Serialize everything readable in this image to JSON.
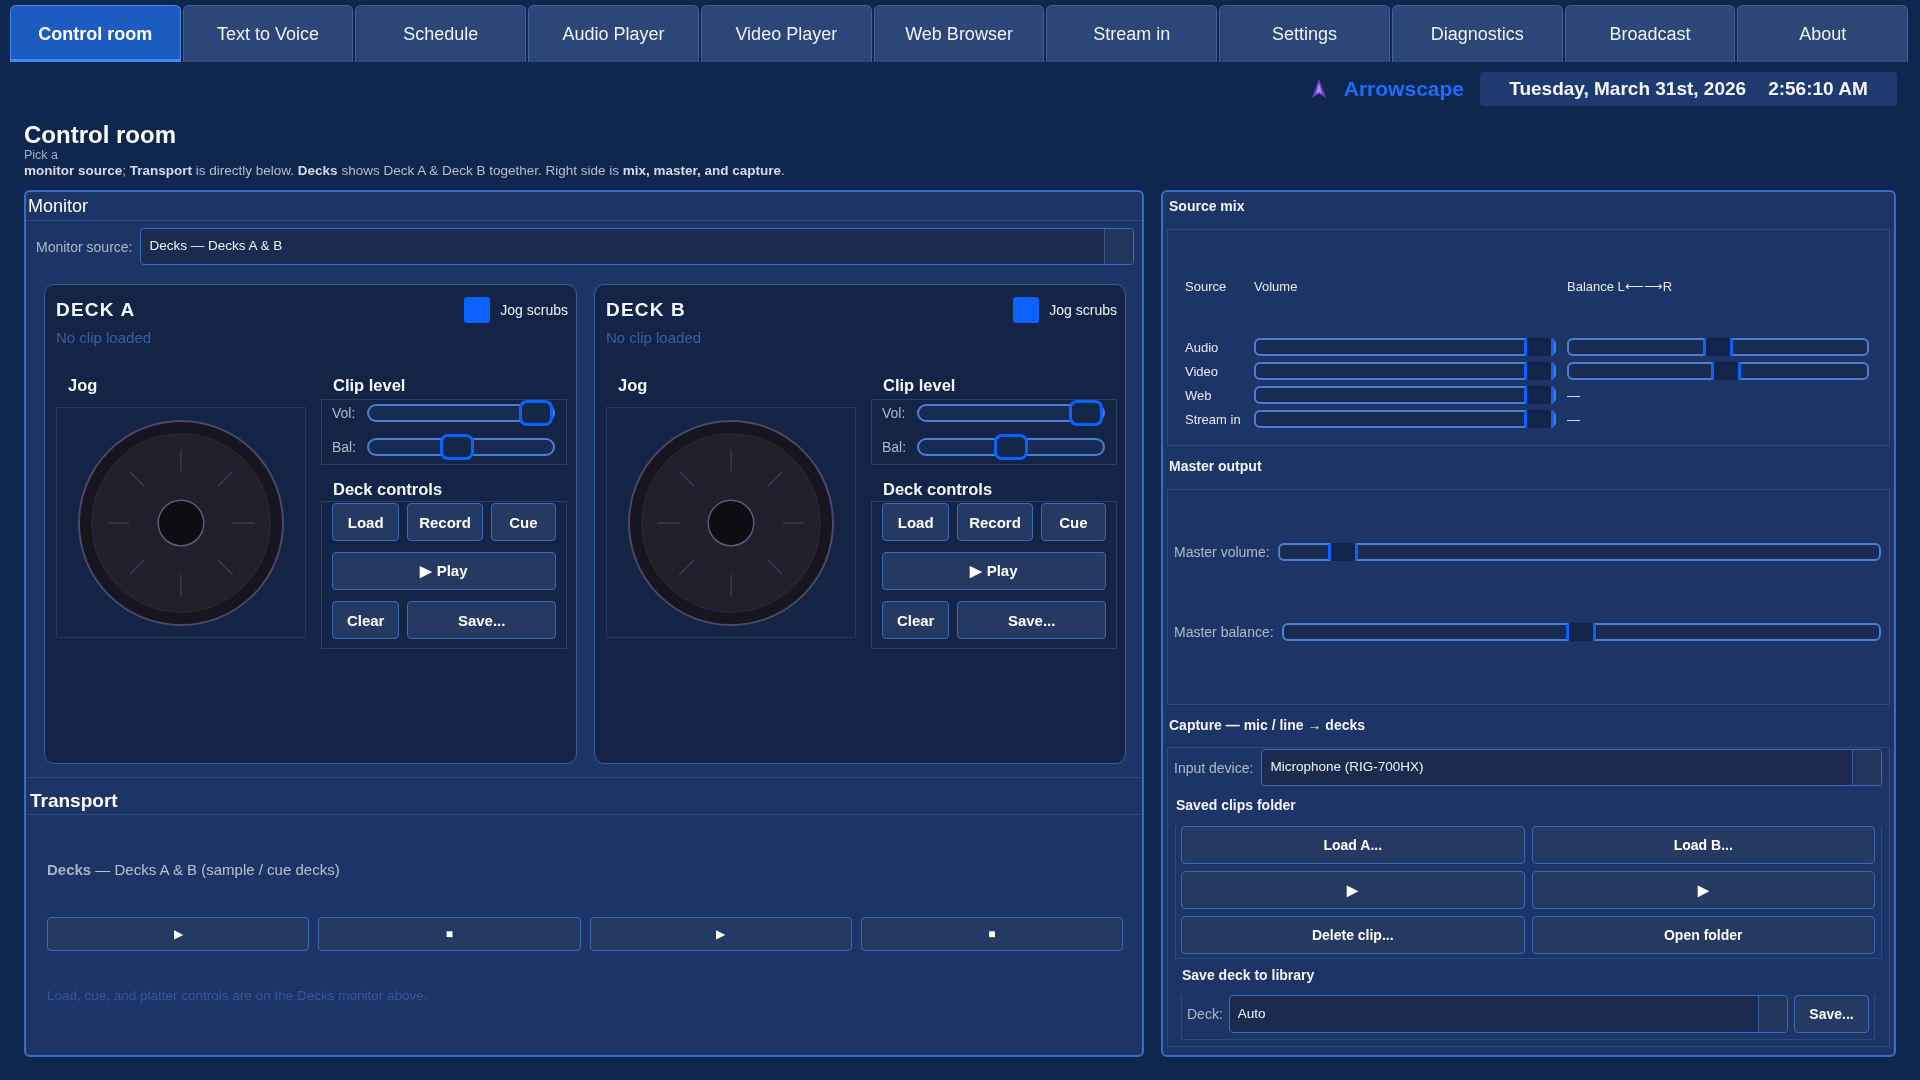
{
  "tabs": [
    {
      "label": "Control room",
      "selected": true
    },
    {
      "label": "Text to Voice",
      "selected": false
    },
    {
      "label": "Schedule",
      "selected": false
    },
    {
      "label": "Audio Player",
      "selected": false
    },
    {
      "label": "Video Player",
      "selected": false
    },
    {
      "label": "Web Browser",
      "selected": false
    },
    {
      "label": "Stream in",
      "selected": false
    },
    {
      "label": "Settings",
      "selected": false
    },
    {
      "label": "Diagnostics",
      "selected": false
    },
    {
      "label": "Broadcast",
      "selected": false
    },
    {
      "label": "About",
      "selected": false
    }
  ],
  "brand": {
    "name": "Arrowscape"
  },
  "clock": {
    "date": "Tuesday, March 31st, 2026",
    "time": "2:56:10 AM"
  },
  "page": {
    "title": "Control room",
    "intro": [
      "Pick a",
      "**monitor source**; **Transport** is directly below. **Decks** shows Deck A & Deck B together. Right side is **mix, master, and capture**."
    ]
  },
  "monitor": {
    "title": "Monitor",
    "source": {
      "label": "Monitor source:",
      "value": "Decks — Decks A & B"
    },
    "decks": [
      {
        "title": "DECK A",
        "jog_scrubs": {
          "label": "Jog scrubs",
          "checked": true
        },
        "status": "No clip loaded",
        "jog_label": "Jog",
        "clip_level": {
          "title": "Clip level",
          "sliders": [
            {
              "label": "Vol:",
              "level": 1
            },
            {
              "label": "Bal:",
              "level": 0.47
            }
          ]
        },
        "controls": {
          "title": "Deck controls",
          "rows": [
            [
              "Load",
              "Record",
              "Cue"
            ],
            [
              "▶ Play"
            ],
            [
              "Clear",
              "Save..."
            ]
          ]
        }
      },
      {
        "title": "DECK B",
        "jog_scrubs": {
          "label": "Jog scrubs",
          "checked": true
        },
        "status": "No clip loaded",
        "jog_label": "Jog",
        "clip_level": {
          "title": "Clip level",
          "sliders": [
            {
              "label": "Vol:",
              "level": 1
            },
            {
              "label": "Bal:",
              "level": 0.5
            }
          ]
        },
        "controls": {
          "title": "Deck controls",
          "rows": [
            [
              "Load",
              "Record",
              "Cue"
            ],
            [
              "▶ Play"
            ],
            [
              "Clear",
              "Save..."
            ]
          ]
        }
      }
    ]
  },
  "transport": {
    "title": "Transport",
    "summary": "**Decks** — Decks A & B (sample / cue decks)",
    "buttons": [
      "▶",
      "■",
      "▶",
      "■"
    ],
    "note": "Load, cue, and platter controls are on the Decks monitor above."
  },
  "source_mix": {
    "title": "Source mix",
    "columns": [
      "Source",
      "Volume",
      "Balance L⟵⟶R"
    ],
    "rows": [
      {
        "name": "Audio",
        "volume": {
          "level": 1
        },
        "balance": {
          "kind": "slider",
          "level": 0.5
        }
      },
      {
        "name": "Video",
        "volume": {
          "level": 1
        },
        "balance": {
          "kind": "slider",
          "level": 0.53
        }
      },
      {
        "name": "Web",
        "volume": {
          "level": 1
        },
        "balance": {
          "kind": "text",
          "text": "—"
        }
      },
      {
        "name": "Stream in",
        "volume": {
          "level": 1
        },
        "balance": {
          "kind": "text",
          "text": "—"
        }
      }
    ]
  },
  "master_output": {
    "title": "Master output",
    "sliders": [
      {
        "label": "Master volume:",
        "level": 0.085
      },
      {
        "label": "Master balance:",
        "level": 0.5
      }
    ]
  },
  "capture": {
    "title": "Capture — mic / line → decks",
    "input": {
      "label": "Input device:",
      "value": "Microphone (RIG-700HX)"
    },
    "clips": {
      "title": "Saved clips folder",
      "buttons": [
        "Load A...",
        "Load B...",
        "▶",
        "▶",
        "Delete clip...",
        "Open folder"
      ]
    },
    "save": {
      "title": "Save deck to library",
      "label": "Deck:",
      "value": "Auto",
      "button": "Save..."
    }
  }
}
